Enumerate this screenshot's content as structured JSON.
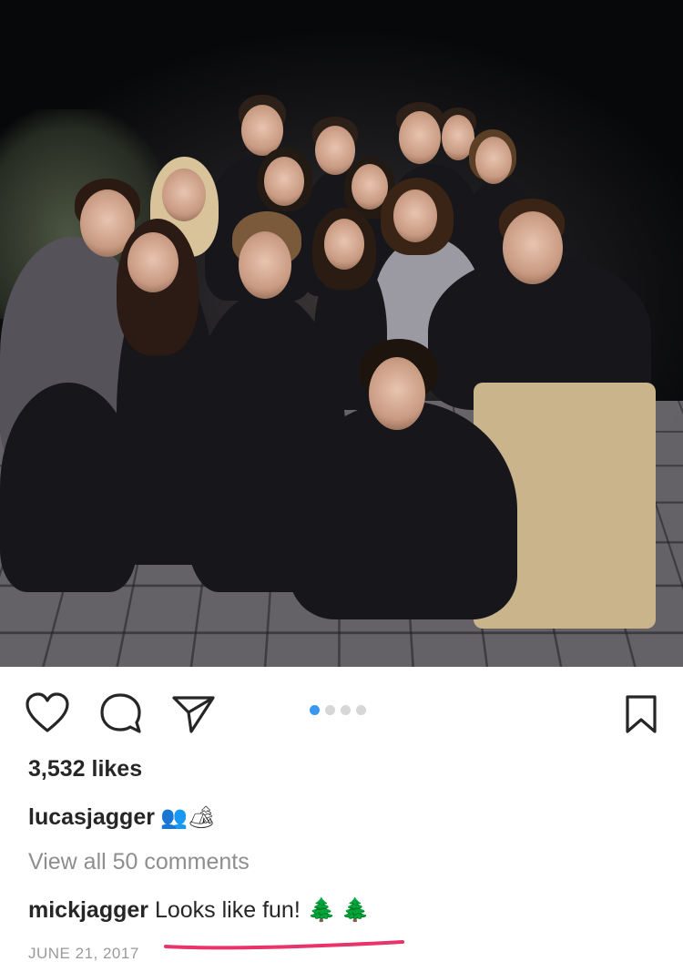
{
  "post": {
    "photo_alt": "",
    "likes_text": "3,532 likes",
    "caption": {
      "username": "lucasjagger",
      "emojis": "👥🏕"
    },
    "view_comments_text": "View all 50 comments",
    "comment": {
      "username": "mickjagger",
      "text": "Looks like fun!",
      "emojis": "🌲🌲"
    },
    "date": "JUNE 21, 2017"
  },
  "carousel": {
    "count": 4,
    "active_index": 0
  },
  "icons": {
    "like": "heart-icon",
    "comment": "comment-bubble-icon",
    "share": "paper-plane-icon",
    "save": "bookmark-icon"
  },
  "colors": {
    "text": "#262626",
    "muted": "#8e8e8e",
    "carousel_active": "#3897f0",
    "carousel_inactive": "#d6d6d6",
    "annotation_underline": "#e8336b"
  }
}
